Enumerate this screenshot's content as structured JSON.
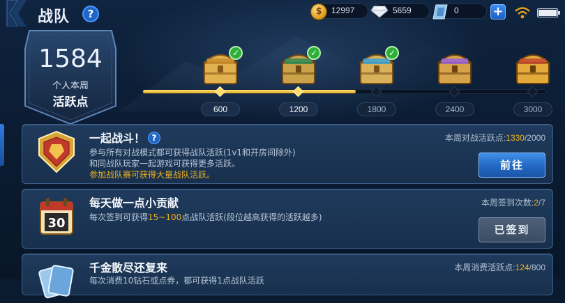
{
  "header": {
    "title": "战队",
    "help_label": "?",
    "gold": "12997",
    "diamonds": "5659",
    "coupons": "0",
    "add_label": "+"
  },
  "weekly": {
    "score": "1584",
    "label_line1": "个人本周",
    "label_line2": "活跃点",
    "progress_fraction": 0.528
  },
  "milestones": [
    {
      "value": "600",
      "claimed": true
    },
    {
      "value": "1200",
      "claimed": true
    },
    {
      "value": "1800",
      "claimed": true
    },
    {
      "value": "2400",
      "claimed": false
    },
    {
      "value": "3000",
      "claimed": false
    }
  ],
  "tasks": [
    {
      "title": "一起战斗！",
      "help_label": "?",
      "desc1": "参与所有对战模式都可获得战队活跃(1v1和开房间除外)",
      "desc2": "和同战队玩家一起游戏可获得更多活跃。",
      "note": "参加战队赛可获得大量战队活跃。",
      "stat_label": "本周对战活跃点:",
      "stat_value": "1330",
      "stat_total": "/2000",
      "button": "前往"
    },
    {
      "title": "每天做一点小贡献",
      "desc_prefix": "每次签到可获得",
      "desc_highlight": "15~100",
      "desc_suffix": "点战队活跃(段位越高获得的活跃越多)",
      "stat_label": "本周签到次数:",
      "stat_value": "2",
      "stat_total": "/7",
      "button": "已签到",
      "calendar_number": "30"
    },
    {
      "title": "千金散尽还复来",
      "desc1": "每次消费10钻石或点券，都可获得1点战队活跃",
      "stat_label": "本周消费活跃点:",
      "stat_value": "124",
      "stat_total": "/800"
    }
  ],
  "colors": {
    "accent_gold": "#f0b21c",
    "button_blue": "#2368c2",
    "card_bg": "#1f3a5c"
  }
}
